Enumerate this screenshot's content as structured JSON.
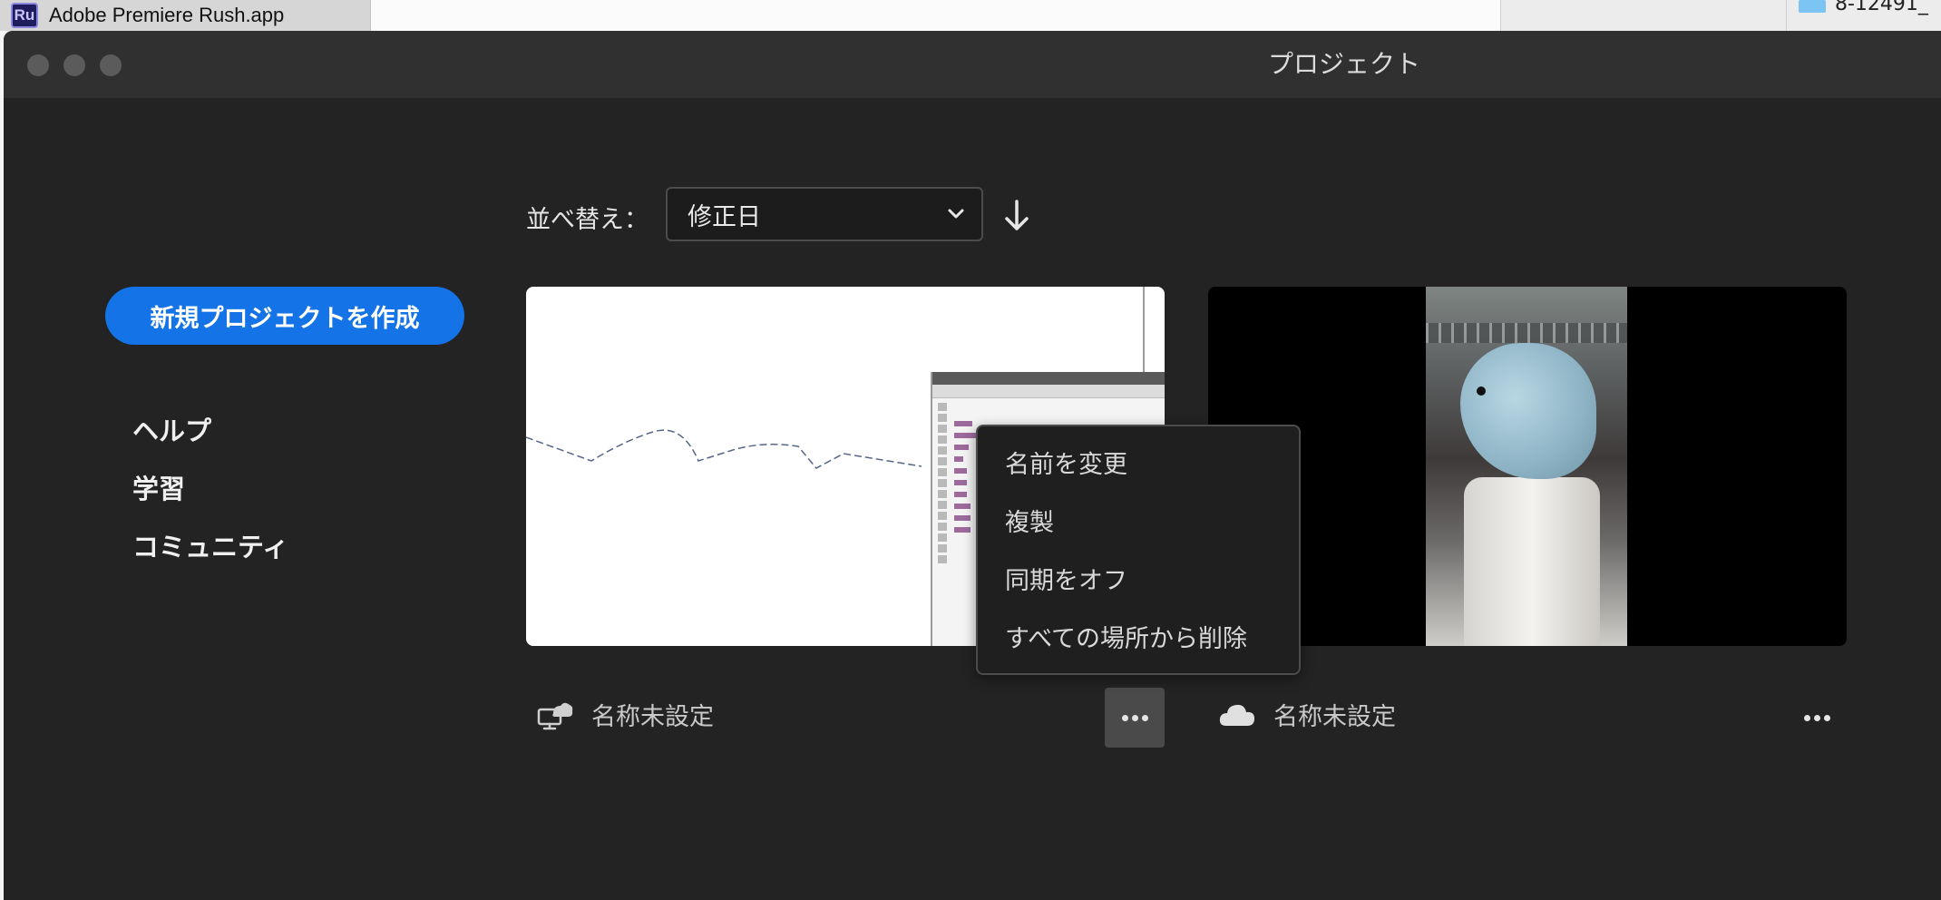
{
  "background": {
    "taskbar_app_title": "Adobe Premiere Rush.app",
    "app_badge": "Ru",
    "finder_item_name": "8-12491_"
  },
  "window": {
    "title": "プロジェクト"
  },
  "sidebar": {
    "new_project_label": "新規プロジェクトを作成",
    "links": [
      {
        "label": "ヘルプ"
      },
      {
        "label": "学習"
      },
      {
        "label": "コミュニティ"
      }
    ]
  },
  "sort": {
    "label": "並べ替え：",
    "selected": "修正日",
    "direction_icon": "arrow-down-icon"
  },
  "projects": [
    {
      "name": "名称未設定",
      "sync_icon": "desktop-cloud-icon",
      "more_active": true
    },
    {
      "name": "名称未設定",
      "sync_icon": "cloud-icon",
      "more_active": false
    }
  ],
  "context_menu": {
    "items": [
      {
        "label": "名前を変更"
      },
      {
        "label": "複製"
      },
      {
        "label": "同期をオフ"
      },
      {
        "label": "すべての場所から削除"
      }
    ]
  },
  "colors": {
    "accent": "#1473e6",
    "window_bg": "#232323",
    "titlebar_bg": "#303030"
  }
}
